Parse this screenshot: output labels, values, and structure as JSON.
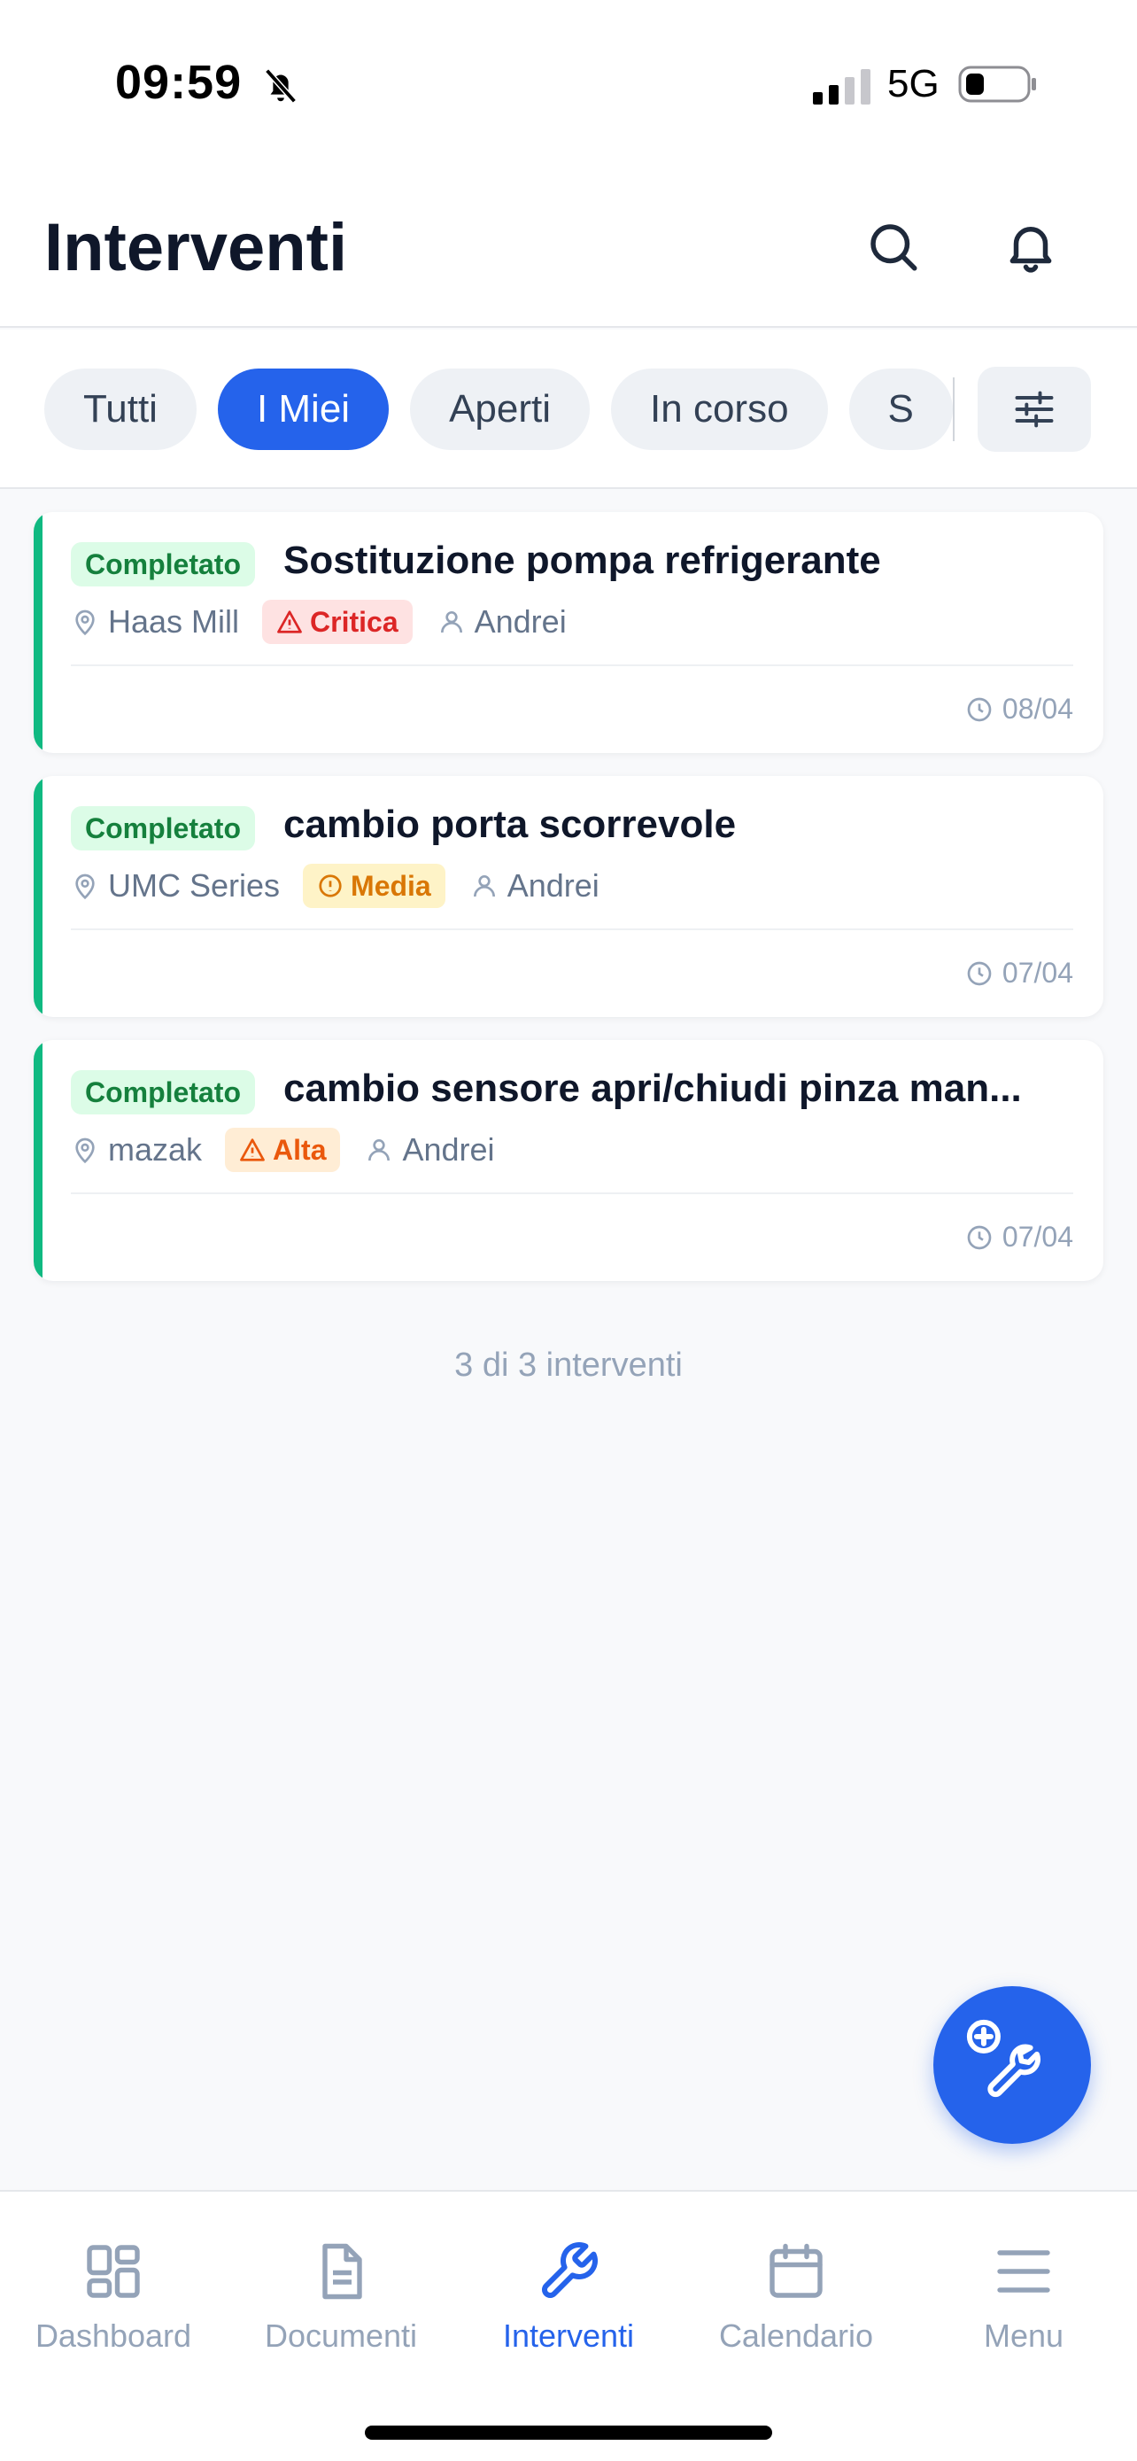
{
  "status_bar": {
    "time": "09:59",
    "network": "5G"
  },
  "header": {
    "title": "Interventi"
  },
  "filters": {
    "chips": [
      {
        "label": "Tutti",
        "active": false
      },
      {
        "label": "I Miei",
        "active": true
      },
      {
        "label": "Aperti",
        "active": false
      },
      {
        "label": "In corso",
        "active": false
      },
      {
        "label": "S",
        "active": false
      }
    ]
  },
  "interventions": [
    {
      "status": "Completato",
      "title": "Sostituzione pompa refrigerante",
      "machine": "Haas Mill",
      "priority": "Critica",
      "assignee": "Andrei",
      "date": "08/04"
    },
    {
      "status": "Completato",
      "title": "cambio porta scorrevole",
      "machine": "UMC Series",
      "priority": "Media",
      "assignee": "Andrei",
      "date": "07/04"
    },
    {
      "status": "Completato",
      "title": "cambio sensore apri/chiudi pinza man...",
      "machine": "mazak",
      "priority": "Alta",
      "assignee": "Andrei",
      "date": "07/04"
    }
  ],
  "summary": {
    "count_text": "3 di 3 interventi"
  },
  "tabbar": {
    "tabs": [
      {
        "label": "Dashboard",
        "icon": "grid-icon",
        "active": false
      },
      {
        "label": "Documenti",
        "icon": "document-icon",
        "active": false
      },
      {
        "label": "Interventi",
        "icon": "wrench-icon",
        "active": true
      },
      {
        "label": "Calendario",
        "icon": "calendar-icon",
        "active": false
      },
      {
        "label": "Menu",
        "icon": "menu-icon",
        "active": false
      }
    ]
  },
  "colors": {
    "accent": "#2563eb",
    "completed": "#10b981",
    "critica": "#dc2626",
    "media": "#d97706",
    "alta": "#ea580c"
  }
}
